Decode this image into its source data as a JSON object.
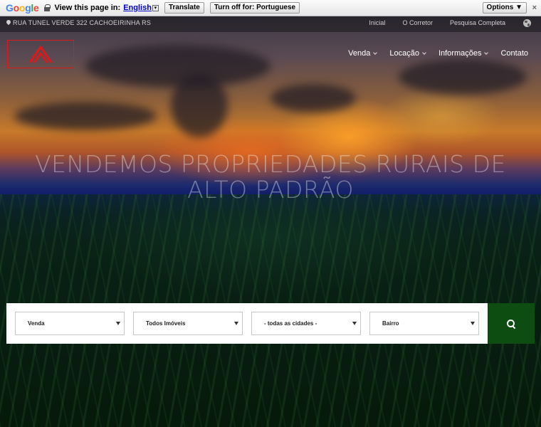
{
  "translate_bar": {
    "logo": "Google",
    "prompt": "View this page in:",
    "language": "English",
    "translate_label": "Translate",
    "turnoff_label": "Turn off for: Portuguese",
    "options_label": "Options ▼",
    "close": "×"
  },
  "topbar": {
    "address": "RUA TUNEL VERDE 322 CACHOEIRINHA RS",
    "links": [
      "Inicial",
      "O Corretor",
      "Pesquisa Completa"
    ]
  },
  "nav": {
    "items": [
      {
        "label": "Venda",
        "dropdown": true
      },
      {
        "label": "Locação",
        "dropdown": true
      },
      {
        "label": "Informações",
        "dropdown": true
      },
      {
        "label": "Contato",
        "dropdown": false
      }
    ]
  },
  "hero": {
    "headline_line1": "VENDEMOS PROPRIEDADES RURAIS DE",
    "headline_line2": "ALTO PADRÃO"
  },
  "search": {
    "selects": [
      {
        "value": "Venda"
      },
      {
        "value": "Todos Imóveis"
      },
      {
        "value": "- todas as cidades -"
      },
      {
        "value": "Bairro"
      }
    ],
    "button_icon": "search-icon"
  },
  "colors": {
    "logo_border": "#e01818",
    "search_button": "#0e4d12"
  }
}
